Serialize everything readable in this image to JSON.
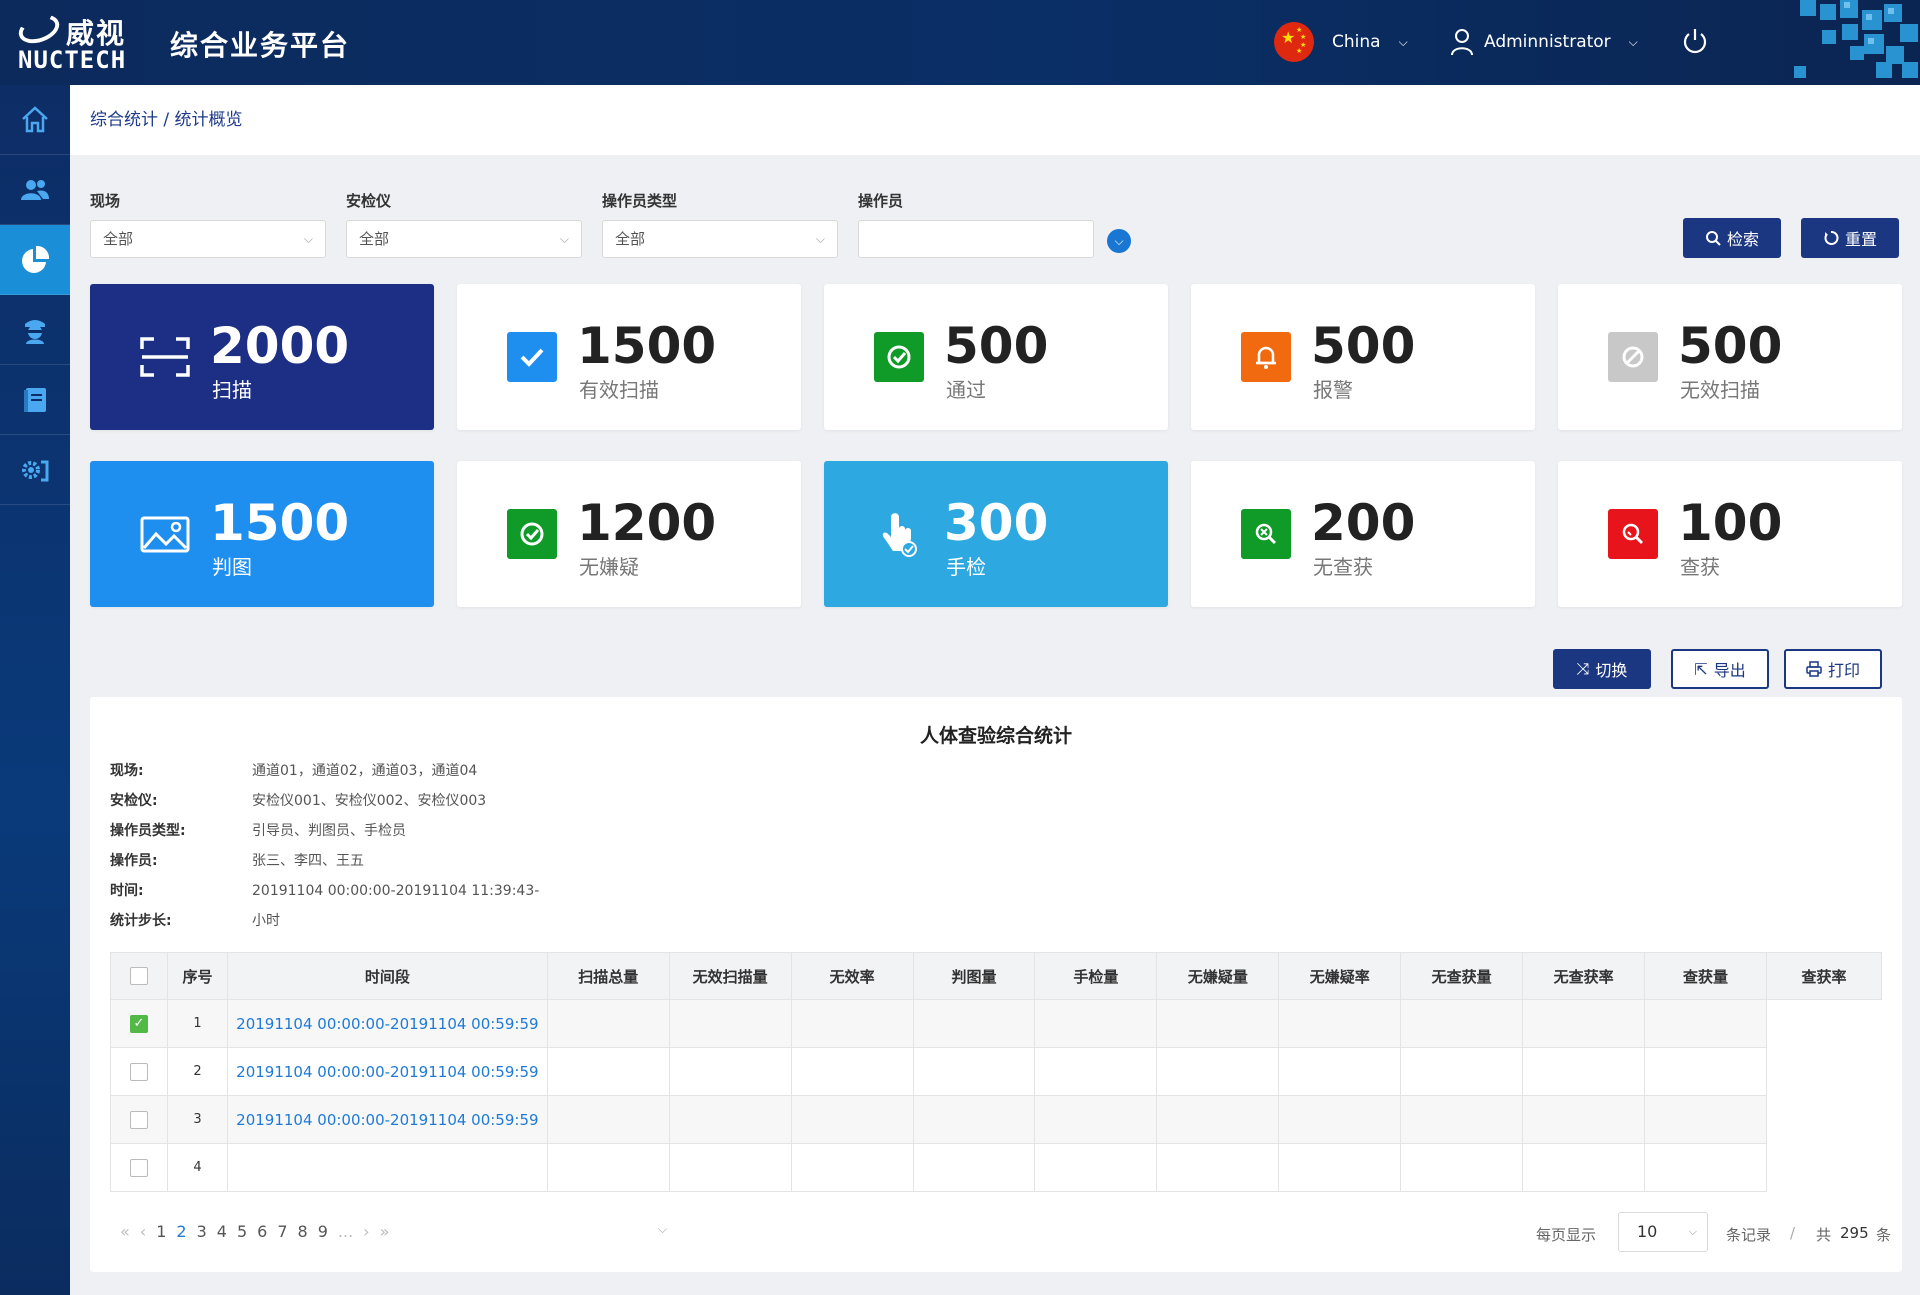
{
  "header": {
    "logo_cn": "威视",
    "logo_en": "NUCTECH",
    "app_title": "综合业务平台",
    "language": "China",
    "user": "Adminnistrator"
  },
  "sidebar": {
    "items": [
      {
        "icon": "home-icon"
      },
      {
        "icon": "users-icon"
      },
      {
        "icon": "pie-chart-icon",
        "active": true
      },
      {
        "icon": "inspector-icon"
      },
      {
        "icon": "book-icon"
      },
      {
        "icon": "settings-icon"
      }
    ]
  },
  "breadcrumb": "综合统计 / 统计概览",
  "filters": {
    "site_label": "现场",
    "site_value": "全部",
    "device_label": "安检仪",
    "device_value": "全部",
    "optype_label": "操作员类型",
    "optype_value": "全部",
    "operator_label": "操作员",
    "operator_value": ""
  },
  "buttons": {
    "search": "检索",
    "reset": "重置",
    "switch": "切换",
    "export": "导出",
    "print": "打印"
  },
  "stats": [
    {
      "value": "2000",
      "label": "扫描",
      "icon": "scan-icon",
      "color": "#1c2f85"
    },
    {
      "value": "1500",
      "label": "有效扫描",
      "icon": "check-icon",
      "color": "#1e8eef"
    },
    {
      "value": "500",
      "label": "通过",
      "icon": "pass-icon",
      "color": "#109a27"
    },
    {
      "value": "500",
      "label": "报警",
      "icon": "bell-icon",
      "color": "#f26a10"
    },
    {
      "value": "500",
      "label": "无效扫描",
      "icon": "ban-icon",
      "color": "#c8c8c8"
    },
    {
      "value": "1500",
      "label": "判图",
      "icon": "image-icon",
      "color": "#1e8eef"
    },
    {
      "value": "1200",
      "label": "无嫌疑",
      "icon": "pass-icon",
      "color": "#109a27"
    },
    {
      "value": "300",
      "label": "手检",
      "icon": "hand-icon",
      "color": "#2ea8e0"
    },
    {
      "value": "200",
      "label": "无查获",
      "icon": "search-x-icon",
      "color": "#109a27"
    },
    {
      "value": "100",
      "label": "查获",
      "icon": "search-icon",
      "color": "#e8141c"
    }
  ],
  "report": {
    "title": "人体查验综合统计",
    "meta": [
      {
        "k": "现场:",
        "v": "通道01，通道02，通道03，通道04"
      },
      {
        "k": "安检仪:",
        "v": "安检仪001、安检仪002、安检仪003"
      },
      {
        "k": "操作员类型:",
        "v": "引导员、判图员、手检员"
      },
      {
        "k": "操作员:",
        "v": "张三、李四、王五"
      },
      {
        "k": "时间:",
        "v": "20191104 00:00:00-20191104 11:39:43-"
      },
      {
        "k": "统计步长:",
        "v": "小时"
      }
    ],
    "columns": [
      "序号",
      "时间段",
      "扫描总量",
      "无效扫描量",
      "无效率",
      "判图量",
      "手检量",
      "无嫌疑量",
      "无嫌疑率",
      "无查获量",
      "无查获率",
      "查获量",
      "查获率"
    ],
    "rows": [
      {
        "no": "1",
        "period": "20191104 00:00:00-20191104 00:59:59",
        "checked": true
      },
      {
        "no": "2",
        "period": "20191104 00:00:00-20191104 00:59:59",
        "checked": false
      },
      {
        "no": "3",
        "period": "20191104 00:00:00-20191104 00:59:59",
        "checked": false
      },
      {
        "no": "4",
        "period": "",
        "checked": false
      }
    ]
  },
  "pagination": {
    "pages": [
      "1",
      "2",
      "3",
      "4",
      "5",
      "6",
      "7",
      "8",
      "9",
      "..."
    ],
    "current": "2",
    "per_page_label": "每页显示",
    "per_page": "10",
    "records_label": "条记录",
    "sep": "/",
    "total_prefix": "共",
    "total": "295",
    "total_suffix": "条"
  },
  "colors": {
    "navy": "#1c2f85",
    "accent": "#1e8eef",
    "link": "#1f7ad6"
  }
}
